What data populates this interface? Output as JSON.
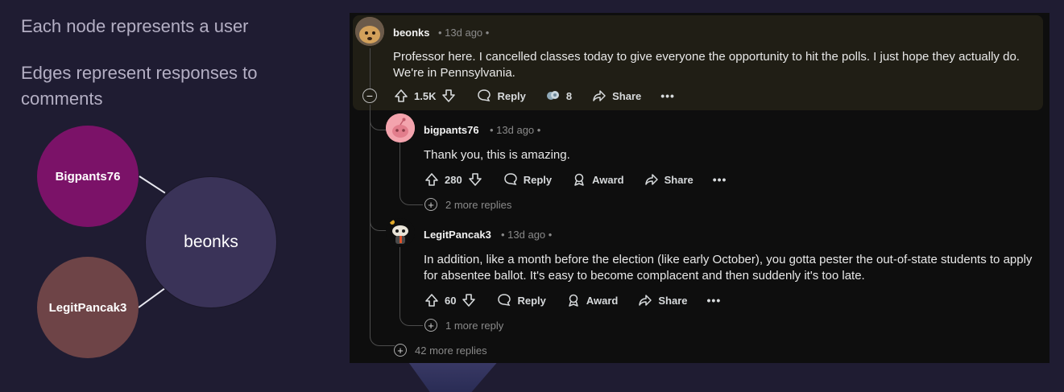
{
  "slide": {
    "caption1": "Each node represents a user",
    "caption2": "Edges represent responses to comments"
  },
  "graph": {
    "nodes": [
      {
        "id": "bigpants",
        "label": "Bigpants76",
        "color": "#7b1268"
      },
      {
        "id": "legit",
        "label": "LegitPancak3",
        "color": "#6e4447"
      },
      {
        "id": "beonks",
        "label": "beonks",
        "color": "#3a3358"
      }
    ]
  },
  "comments": {
    "main": {
      "username": "beonks",
      "meta": "• 13d ago •",
      "text": "Professor here. I cancelled classes today to give everyone the opportunity to hit the polls. I just hope they actually do. We're in Pennsylvania.",
      "votes": "1.5K",
      "reply_label": "Reply",
      "award_count": "8",
      "share_label": "Share",
      "more": "•••"
    },
    "reply1": {
      "username": "bigpants76",
      "meta": "• 13d ago •",
      "text": "Thank you, this is amazing.",
      "votes": "280",
      "reply_label": "Reply",
      "award_label": "Award",
      "share_label": "Share",
      "more": "•••",
      "more_replies": "2 more replies"
    },
    "reply2": {
      "username": "LegitPancak3",
      "meta": "• 13d ago •",
      "text": "In addition, like a month before the election (like early October), you gotta pester the out-of-state students to apply for absentee ballot. It's easy to become complacent and then suddenly it's too late.",
      "votes": "60",
      "reply_label": "Reply",
      "award_label": "Award",
      "share_label": "Share",
      "more": "•••",
      "more_replies": "1 more reply"
    },
    "thread_more": "42 more replies"
  },
  "icons": {
    "upvote": "arrow-up-icon",
    "downvote": "arrow-down-icon",
    "reply": "speech-bubble-icon",
    "award": "award-icon",
    "share": "share-arrow-icon",
    "collapse": "collapse-minus-icon",
    "expand": "expand-plus-icon"
  },
  "colors": {
    "slide_bg": "#1f1c32",
    "panel_bg": "#0e0e0e",
    "highlight_bg": "#201e15"
  }
}
